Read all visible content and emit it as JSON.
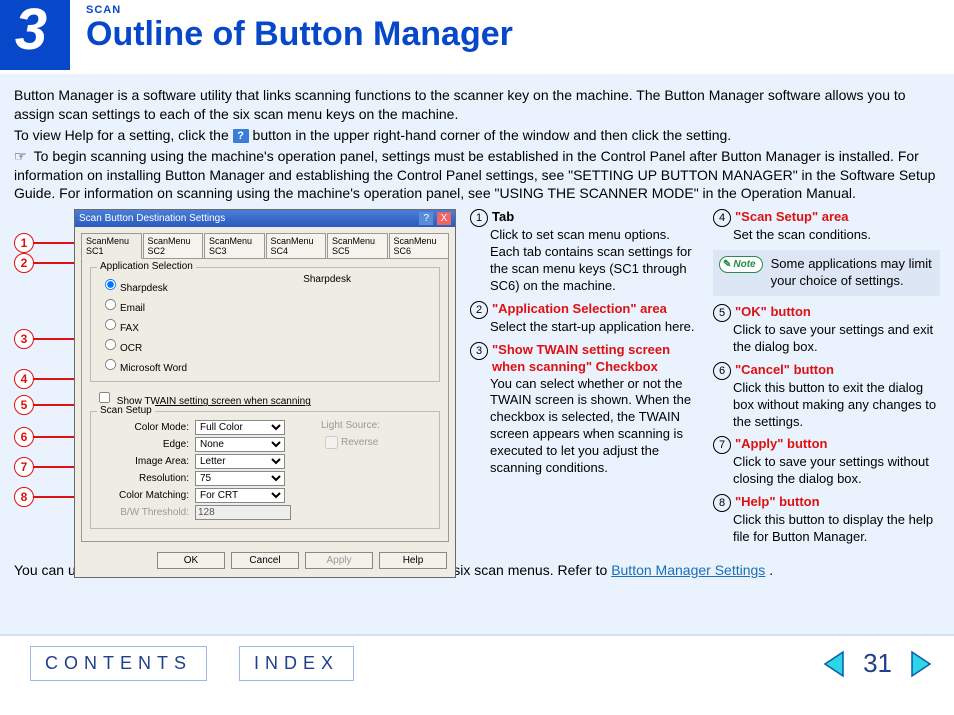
{
  "chapter": "3",
  "section_label": "SCAN",
  "title": "Outline of Button Manager",
  "intro": {
    "p1": "Button Manager is a software utility that links scanning functions to the scanner key on the machine. The Button Manager software allows you to assign scan settings to each of the six scan menu keys on the machine.",
    "p2a": "To view Help for a setting, click the ",
    "help_icon": "?",
    "p2b": " button in the upper right-hand corner of the window and then click the setting.",
    "p3": "To begin scanning using the machine's operation panel, settings must be established in the Control Panel after Button Manager is installed. For information on installing Button Manager and establishing the Control Panel settings, see \"SETTING UP BUTTON MANAGER\" in the Software Setup Guide. For information on scanning using the machine's operation panel, see \"USING THE SCANNER MODE\" in the Operation Manual."
  },
  "dialog": {
    "title": "Scan Button Destination Settings",
    "tabs": [
      "ScanMenu SC1",
      "ScanMenu SC2",
      "ScanMenu SC3",
      "ScanMenu SC4",
      "ScanMenu SC5",
      "ScanMenu SC6"
    ],
    "app_sel_title": "Application Selection",
    "apps": [
      "Sharpdesk",
      "Email",
      "FAX",
      "OCR",
      "Microsoft Word"
    ],
    "app_right": "Sharpdesk",
    "twain_chk": "Show TWAIN setting screen when scanning",
    "scan_setup_title": "Scan Setup",
    "fields": {
      "color_mode_lbl": "Color Mode:",
      "color_mode": "Full Color",
      "edge_lbl": "Edge:",
      "edge": "None",
      "image_area_lbl": "Image Area:",
      "image_area": "Letter",
      "resolution_lbl": "Resolution:",
      "resolution": "75",
      "color_match_lbl": "Color Matching:",
      "color_match": "For CRT",
      "bw_thresh_lbl": "B/W Threshold:",
      "bw_thresh": "128",
      "light_src_lbl": "Light Source:",
      "reverse_lbl": "Reverse"
    },
    "buttons": {
      "ok": "OK",
      "cancel": "Cancel",
      "apply": "Apply",
      "help": "Help"
    }
  },
  "explanations": {
    "c1": {
      "i1": {
        "t": "Tab",
        "b": "Click to set scan menu options. Each tab contains scan settings for the scan menu keys (SC1 through SC6) on the machine."
      },
      "i2": {
        "t": "\"Application Selection\" area",
        "b": "Select the start-up application here."
      },
      "i3": {
        "t": "\"Show TWAIN setting screen when scanning\" Checkbox",
        "b": "You can select whether or not the TWAIN screen is shown. When the checkbox is selected, the TWAIN screen appears when scanning is executed to let you adjust the scanning conditions."
      }
    },
    "c2": {
      "i4": {
        "t": "\"Scan Setup\" area",
        "b": "Set the scan conditions."
      },
      "note": "Some applications may limit your choice of settings.",
      "note_label": "Note",
      "i5": {
        "t": "\"OK\" button",
        "b": "Click to save your settings and exit the dialog box."
      },
      "i6": {
        "t": "\"Cancel\" button",
        "b": "Click this button to exit the dialog box without making any changes to the settings."
      },
      "i7": {
        "t": "\"Apply\" button",
        "b": "Click to save your settings without closing the dialog box."
      },
      "i8": {
        "t": "\"Help\" button",
        "b": "Click this button to display the help file for Button Manager."
      }
    }
  },
  "bottom": {
    "text": "You can use Button Manager to select and change the functions of the six scan menus. Refer to ",
    "link": "Button Manager Settings",
    "after": "."
  },
  "footer": {
    "contents": "CONTENTS",
    "index": "INDEX",
    "page": "31"
  },
  "nums": {
    "n1": "1",
    "n2": "2",
    "n3": "3",
    "n4": "4",
    "n5": "5",
    "n6": "6",
    "n7": "7",
    "n8": "8"
  }
}
